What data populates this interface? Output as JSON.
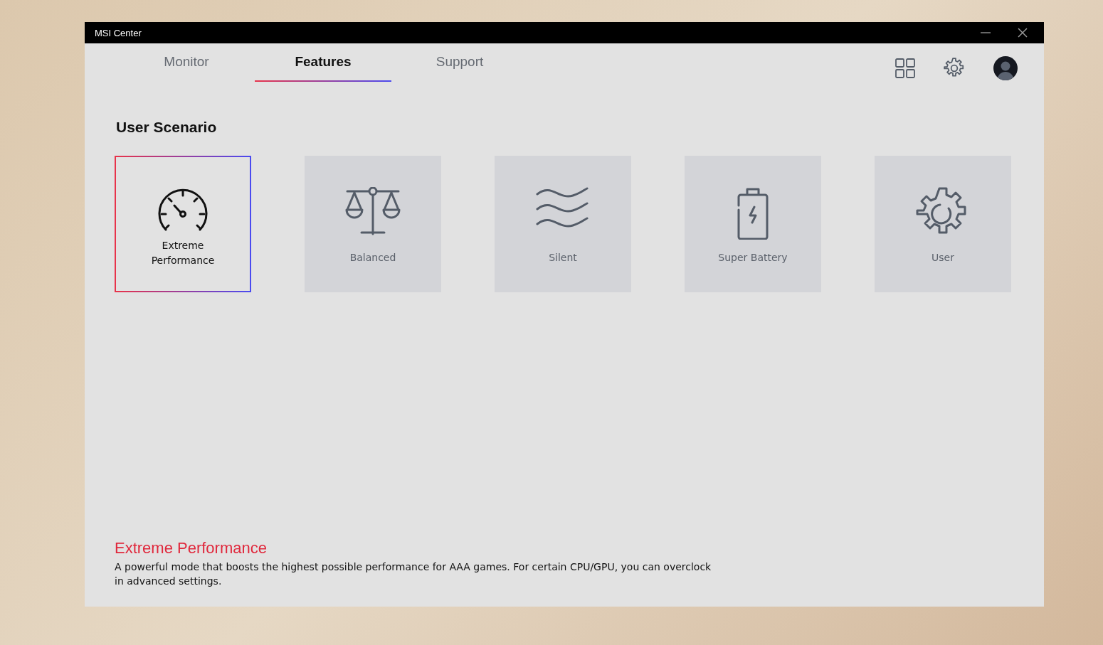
{
  "window": {
    "title": "MSI Center"
  },
  "tabs": [
    {
      "label": "Monitor",
      "selected": false
    },
    {
      "label": "Features",
      "selected": true
    },
    {
      "label": "Support",
      "selected": false
    }
  ],
  "section_title": "User Scenario",
  "scenarios": [
    {
      "label": "Extreme Performance",
      "kind": "speedometer",
      "selected": true
    },
    {
      "label": "Balanced",
      "kind": "scale",
      "selected": false
    },
    {
      "label": "Silent",
      "kind": "waves",
      "selected": false
    },
    {
      "label": "Super Battery",
      "kind": "battery",
      "selected": false
    },
    {
      "label": "User",
      "kind": "gear",
      "selected": false
    }
  ],
  "description": {
    "title": "Extreme Performance",
    "text": "A powerful mode that boosts the highest possible performance for AAA games. For certain CPU/GPU, you can overclock in advanced settings."
  }
}
